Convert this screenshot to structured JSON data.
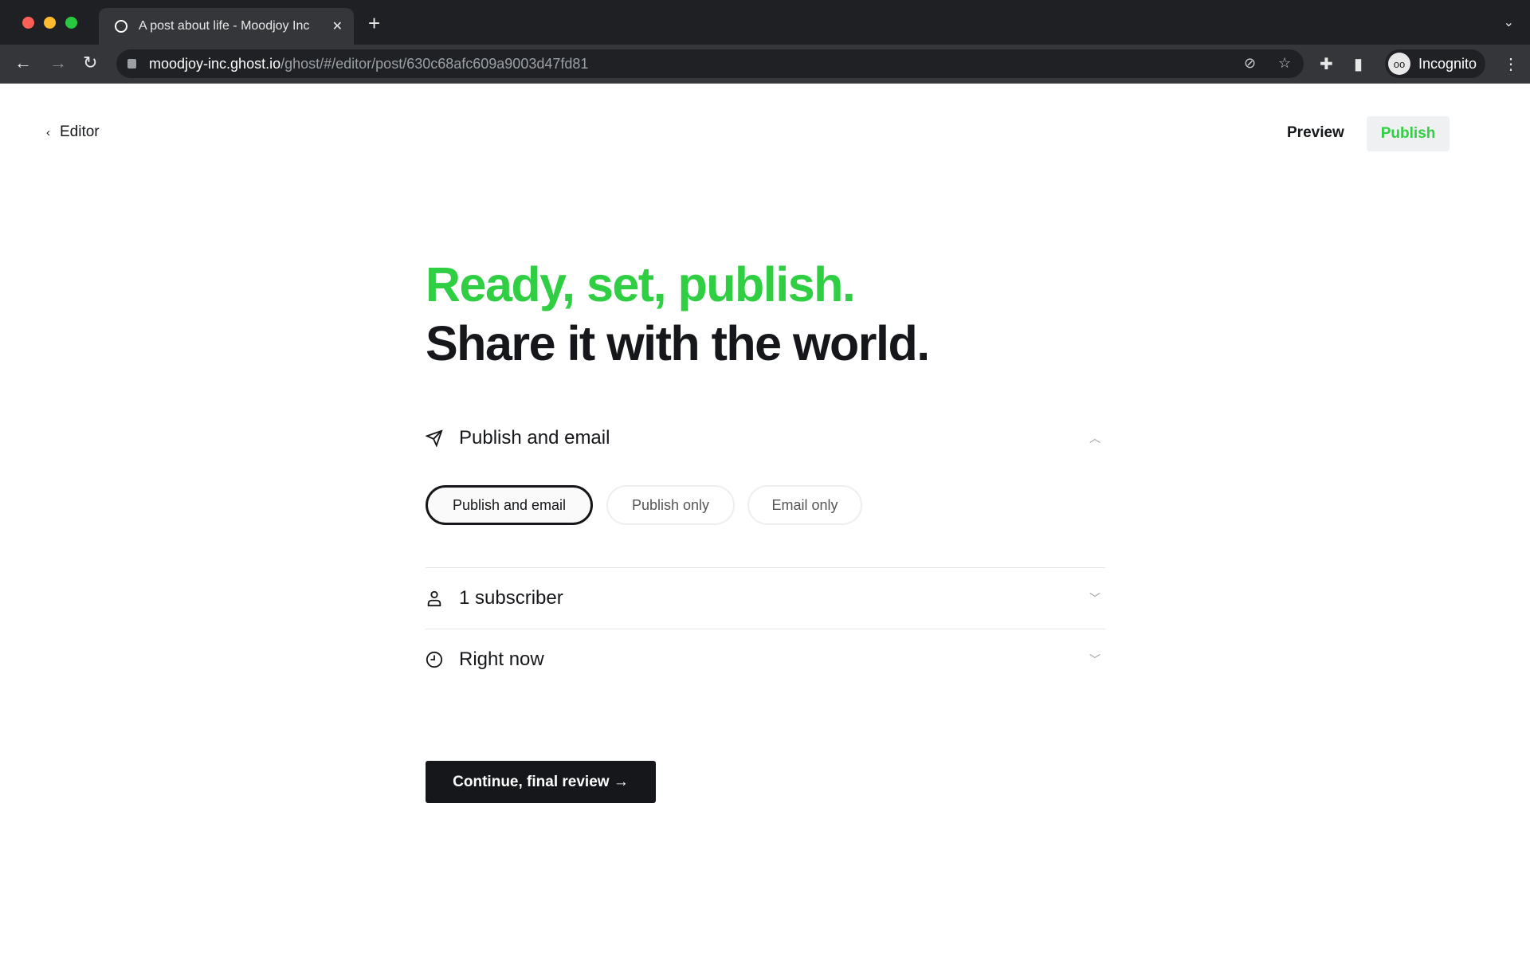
{
  "browser": {
    "tab_title": "A post about life - Moodjoy Inc",
    "url_host": "moodjoy-inc.ghost.io",
    "url_path": "/ghost/#/editor/post/630c68afc609a9003d47fd81",
    "profile": "Incognito"
  },
  "header": {
    "back_label": "Editor",
    "preview_label": "Preview",
    "publish_label": "Publish"
  },
  "main": {
    "headline_green": "Ready, set, publish.",
    "headline_dark": "Share it with the world.",
    "publish_type": {
      "label": "Publish and email",
      "options": [
        "Publish and email",
        "Publish only",
        "Email only"
      ],
      "selected": "Publish and email"
    },
    "audience": {
      "label": "1 subscriber"
    },
    "schedule": {
      "label": "Right now"
    },
    "continue_label": "Continue, final review →"
  },
  "colors": {
    "accent": "#30cf43",
    "dark": "#15171a"
  }
}
